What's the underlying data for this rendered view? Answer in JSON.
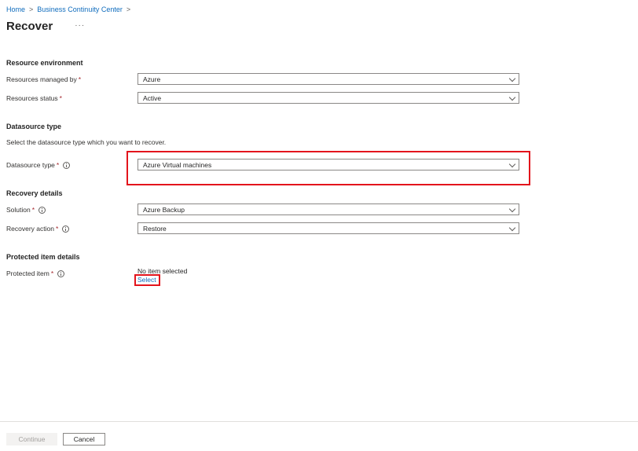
{
  "breadcrumb": {
    "items": [
      "Home",
      "Business Continuity Center"
    ],
    "separator": ">"
  },
  "header": {
    "title": "Recover",
    "more_label": "···"
  },
  "resource_environment": {
    "section_title": "Resource environment",
    "managed_by": {
      "label": "Resources managed by",
      "value": "Azure"
    },
    "status": {
      "label": "Resources status",
      "value": "Active"
    }
  },
  "datasource": {
    "section_title": "Datasource type",
    "description": "Select the datasource type which you want to recover.",
    "type": {
      "label": "Datasource type",
      "value": "Azure Virtual machines"
    }
  },
  "recovery": {
    "section_title": "Recovery details",
    "solution": {
      "label": "Solution",
      "value": "Azure Backup"
    },
    "action": {
      "label": "Recovery action",
      "value": "Restore"
    }
  },
  "protected": {
    "section_title": "Protected item details",
    "item": {
      "label": "Protected item",
      "value": "No item selected",
      "link": "Select"
    }
  },
  "required_marker": "*",
  "footer": {
    "continue_label": "Continue",
    "cancel_label": "Cancel"
  },
  "colors": {
    "link": "#0f6cbd",
    "required": "#a4262c",
    "highlight": "#e3141c",
    "disabled_text": "#a19f9d"
  }
}
